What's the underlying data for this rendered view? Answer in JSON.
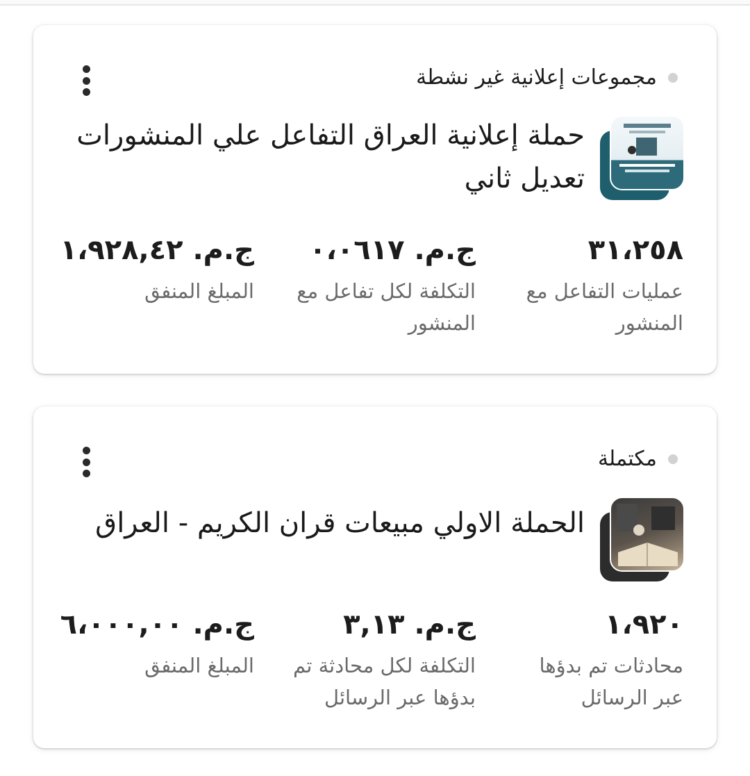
{
  "cards": [
    {
      "status": "مجموعات إعلانية غير نشطة",
      "title": "حملة إعلانية العراق التفاعل علي المنشورات تعديل ثاني",
      "thumbnail": "campaign-thumbnail",
      "metrics": [
        {
          "value": "٣١،٢٥٨",
          "label": "عمليات  التفاعل مع المنشور"
        },
        {
          "value": "ج.م. ٠،٠٦١٧",
          "label": "التكلفة لكل تفاعل مع المنشور"
        },
        {
          "value": "ج.م. ١،٩٢٨,٤٢",
          "label": "المبلغ المنفق"
        }
      ]
    },
    {
      "status": "مكتملة",
      "title": "الحملة الاولي مبيعات قران الكريم - العراق",
      "thumbnail": "campaign-thumbnail",
      "metrics": [
        {
          "value": "١،٩٢٠",
          "label": "محادثات تم بدؤها عبر الرسائل"
        },
        {
          "value": "ج.م. ٣,١٣",
          "label": "التكلفة لكل محادثة تم بدؤها عبر الرسائل"
        },
        {
          "value": "ج.م. ٦،٠٠٠,٠٠",
          "label": "المبلغ المنفق"
        }
      ]
    }
  ],
  "icons": {
    "menu": "more-vertical-icon",
    "status": "status-dot-icon"
  },
  "colors": {
    "status_dot": "#d2d2d2",
    "label": "#6a6a6a",
    "text": "#1a1a1a"
  }
}
